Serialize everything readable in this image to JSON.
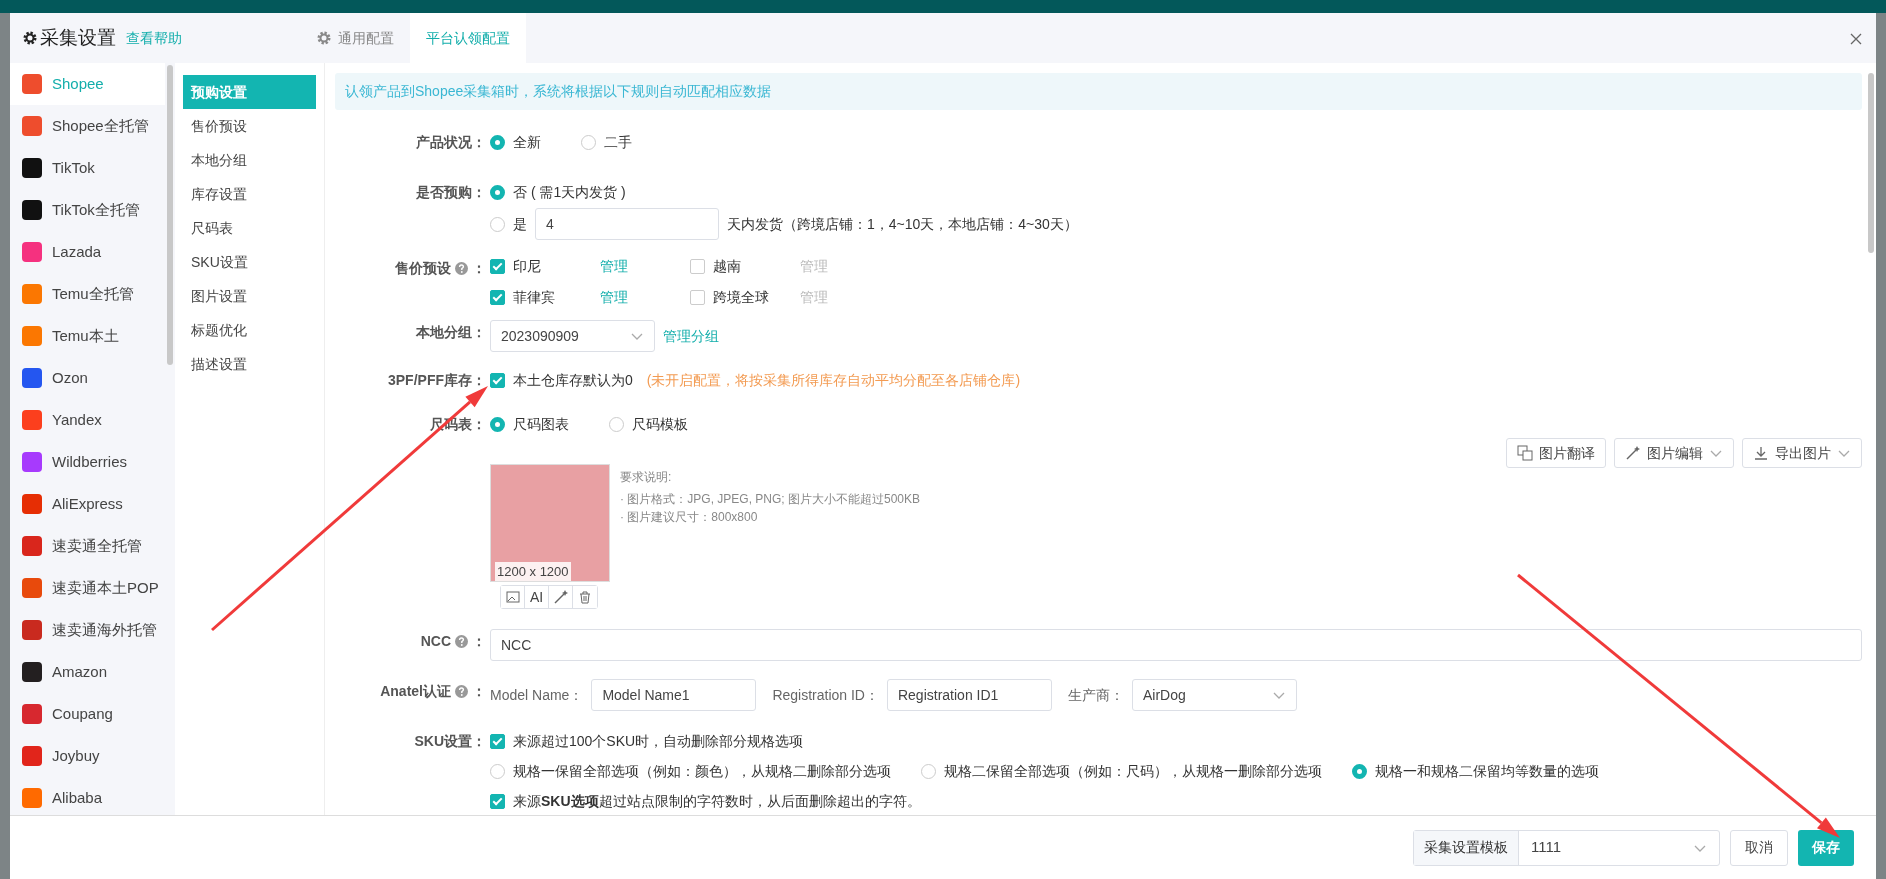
{
  "modal": {
    "title": "采集设置",
    "help_link": "查看帮助",
    "tabs": [
      {
        "label": "通用配置",
        "selected": false,
        "kind": "settings"
      },
      {
        "label": "平台认领配置",
        "selected": true,
        "kind": "plain"
      }
    ]
  },
  "platforms": [
    {
      "label": "Shopee",
      "selected": true,
      "color": "#ee4d2d"
    },
    {
      "label": "Shopee全托管",
      "selected": false,
      "color": "#ee4d2d"
    },
    {
      "label": "TikTok",
      "selected": false,
      "color": "#111111"
    },
    {
      "label": "TikTok全托管",
      "selected": false,
      "color": "#111111"
    },
    {
      "label": "Lazada",
      "selected": false,
      "color": "#f5317f"
    },
    {
      "label": "Temu全托管",
      "selected": false,
      "color": "#fb7701"
    },
    {
      "label": "Temu本土",
      "selected": false,
      "color": "#fb7701"
    },
    {
      "label": "Ozon",
      "selected": false,
      "color": "#2456f0"
    },
    {
      "label": "Yandex",
      "selected": false,
      "color": "#fc3f1d"
    },
    {
      "label": "Wildberries",
      "selected": false,
      "color": "#a73afd"
    },
    {
      "label": "AliExpress",
      "selected": false,
      "color": "#e62e04"
    },
    {
      "label": "速卖通全托管",
      "selected": false,
      "color": "#d9261c"
    },
    {
      "label": "速卖通本土POP",
      "selected": false,
      "color": "#e84a0c"
    },
    {
      "label": "速卖通海外托管",
      "selected": false,
      "color": "#c92a1f"
    },
    {
      "label": "Amazon",
      "selected": false,
      "color": "#231f20"
    },
    {
      "label": "Coupang",
      "selected": false,
      "color": "#d7282f"
    },
    {
      "label": "Joybuy",
      "selected": false,
      "color": "#e1251b"
    },
    {
      "label": "Alibaba",
      "selected": false,
      "color": "#ff6a00"
    }
  ],
  "sections": [
    {
      "label": "预购设置",
      "selected": true
    },
    {
      "label": "售价预设",
      "selected": false
    },
    {
      "label": "本地分组",
      "selected": false
    },
    {
      "label": "库存设置",
      "selected": false
    },
    {
      "label": "尺码表",
      "selected": false
    },
    {
      "label": "SKU设置",
      "selected": false
    },
    {
      "label": "图片设置",
      "selected": false
    },
    {
      "label": "标题优化",
      "selected": false
    },
    {
      "label": "描述设置",
      "selected": false
    }
  ],
  "notice": "认领产品到Shopee采集箱时，系统将根据以下规则自动匹配相应数据",
  "condition": {
    "label": "产品状况：",
    "options": [
      {
        "label": "全新",
        "selected": true
      },
      {
        "label": "二手",
        "selected": false
      }
    ]
  },
  "preorder": {
    "label": "是否预购：",
    "no_option": {
      "label": "否 ( 需1天内发货 )",
      "selected": true
    },
    "yes_option": {
      "label": "是",
      "selected": false
    },
    "days": "4",
    "days_note": "天内发货（跨境店铺：1，4~10天，本地店铺：4~30天）"
  },
  "price_preset": {
    "label": "售价预设",
    "colon": "：",
    "sites": [
      {
        "label": "印尼",
        "checked": true,
        "link": "管理"
      },
      {
        "label": "越南",
        "checked": false,
        "link": "管理"
      },
      {
        "label": "菲律宾",
        "checked": true,
        "link": "管理"
      },
      {
        "label": "跨境全球",
        "checked": false,
        "link": "管理"
      }
    ]
  },
  "local_group": {
    "label": "本地分组：",
    "value": "2023090909",
    "link": "管理分组"
  },
  "stock": {
    "label": "3PF/PFF库存：",
    "option": {
      "label": "本土仓库存默认为0",
      "checked": true
    },
    "note": "(未开启配置，将按采集所得库存自动平均分配至各店铺仓库)"
  },
  "size_chart": {
    "label": "尺码表：",
    "options": [
      {
        "label": "尺码图表",
        "selected": true
      },
      {
        "label": "尺码模板",
        "selected": false
      }
    ],
    "tools": [
      {
        "label": "图片翻译",
        "kind": "translate"
      },
      {
        "label": "图片编辑",
        "kind": "edit"
      },
      {
        "label": "导出图片",
        "kind": "export"
      }
    ],
    "image_size": "1200 x 1200",
    "ai_label": "AI",
    "requirements_title": "要求说明:",
    "requirements": [
      "· 图片格式：JPG, JPEG, PNG; 图片大小不能超过500KB",
      "· 图片建议尺寸：800x800"
    ]
  },
  "ncc": {
    "label": "NCC",
    "colon": "：",
    "value": "NCC"
  },
  "anatel": {
    "label": "Anatel认证",
    "colon": "：",
    "fields": [
      {
        "label": "Model Name：",
        "value": "Model Name1"
      },
      {
        "label": "Registration ID：",
        "value": "Registration ID1"
      }
    ],
    "maker": {
      "label": "生产商：",
      "value": "AirDog"
    }
  },
  "sku": {
    "label": "SKU设置：",
    "limit": {
      "label": "来源超过100个SKU时，自动删除部分规格选项",
      "checked": true
    },
    "modes": [
      {
        "label": "规格一保留全部选项（例如：颜色），从规格二删除部分选项",
        "selected": false
      },
      {
        "label": "规格二保留全部选项（例如：尺码），从规格一删除部分选项",
        "selected": false
      },
      {
        "label": "规格一和规格二保留均等数量的选项",
        "selected": true
      }
    ],
    "trim": {
      "label": "来源**SKU选项**超过站点限制的字符数时，从后面删除超出的字符。",
      "checked": true
    }
  },
  "footer": {
    "template_label": "采集设置模板",
    "template_value": "1111",
    "cancel": "取消",
    "save": "保存"
  }
}
